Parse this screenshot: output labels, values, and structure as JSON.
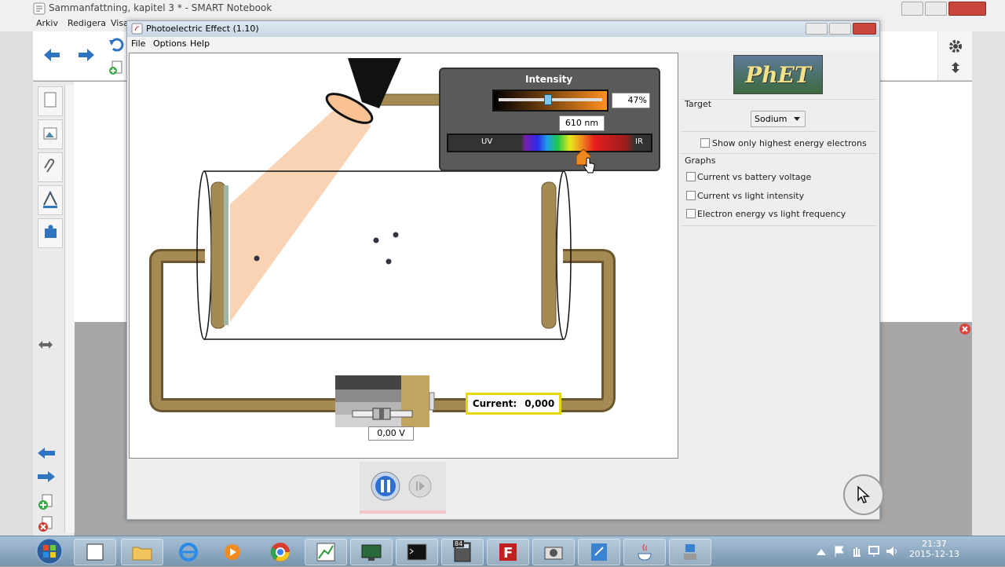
{
  "outer_window": {
    "title": "Sammanfattning, kapitel 3 * - SMART Notebook",
    "menu": [
      "Arkiv",
      "Redigera",
      "Visa"
    ]
  },
  "phet_window": {
    "title": "Photoelectric Effect (1.10)",
    "menu": [
      "File",
      "Options",
      "Help"
    ]
  },
  "intensity": {
    "title": "Intensity",
    "percent": "47%",
    "level": 0.47,
    "wavelength": "610 nm",
    "uv": "UV",
    "ir": "IR"
  },
  "controls": {
    "logo": "PhET",
    "target_label": "Target",
    "target_value": "Sodium",
    "highest_energy": "Show only highest energy electrons",
    "graphs_label": "Graphs",
    "graph_options": [
      "Current vs battery voltage",
      "Current vs light intensity",
      "Electron energy vs light frequency"
    ]
  },
  "circuit": {
    "current_label": "Current:",
    "current_value": "0,000",
    "voltage": "0,00 V"
  },
  "taskbar": {
    "time": "21:37",
    "date": "2015-12-13",
    "badge": "84"
  },
  "colors": {
    "wire": "#a48a53",
    "light_beam": "#f8c8a0",
    "panel_bg": "#5a5a5a",
    "current_border": "#e6d800"
  }
}
